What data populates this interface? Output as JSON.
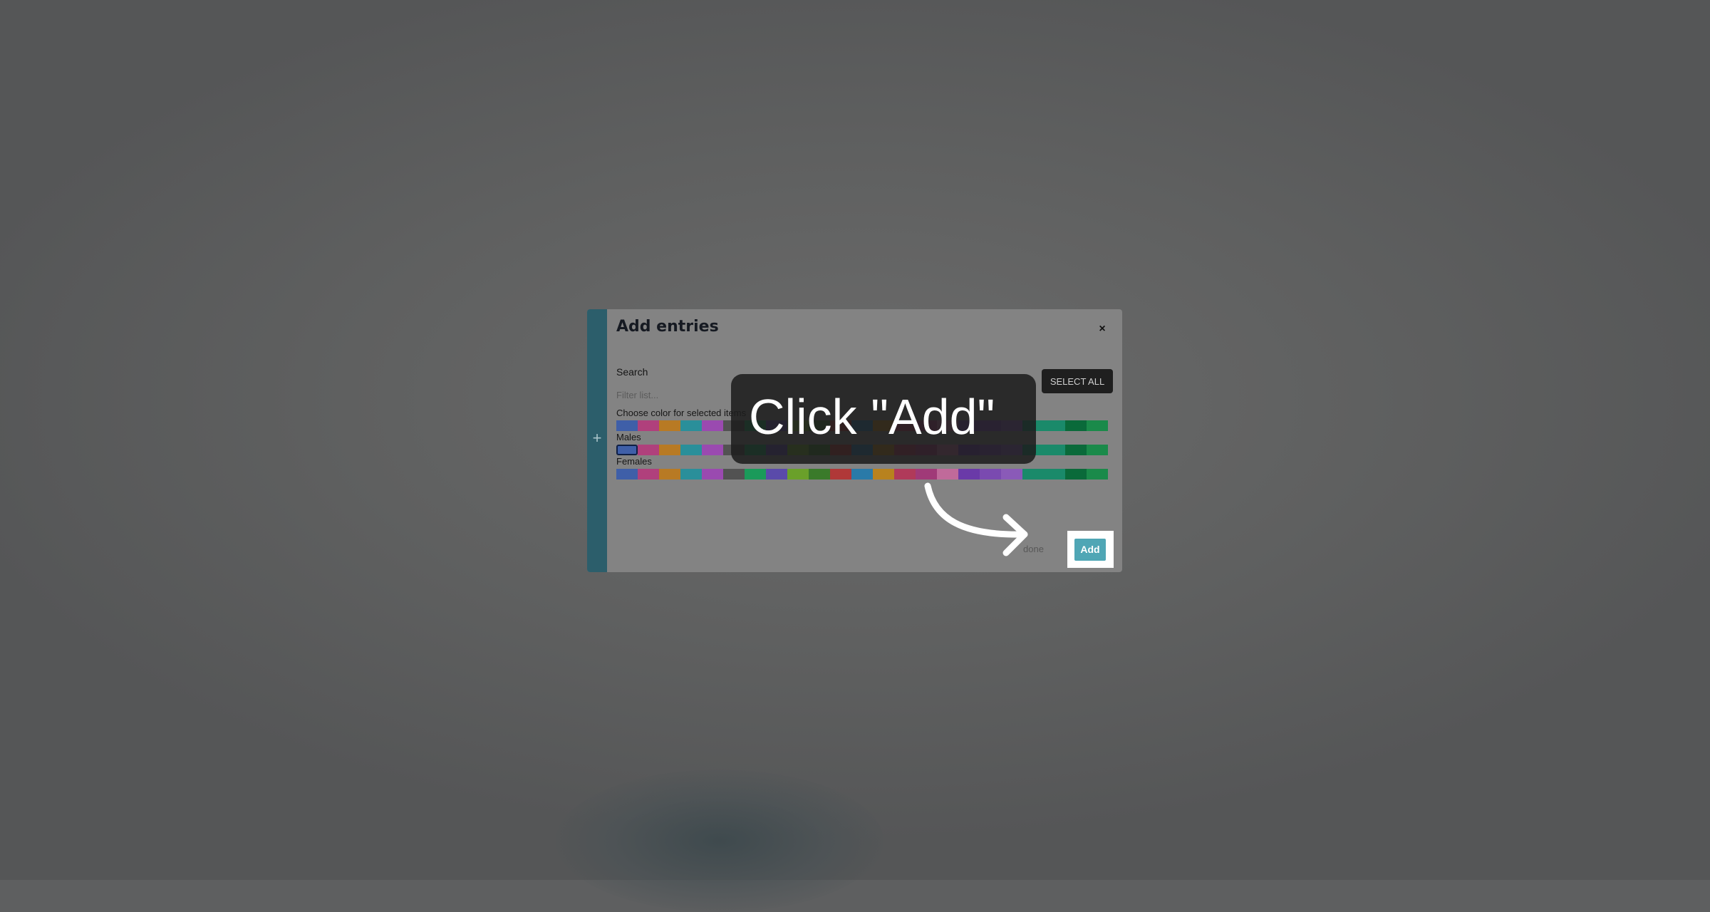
{
  "dialog": {
    "title": "Add entries",
    "close_label": "×",
    "side_plus": "+",
    "search_label": "Search",
    "filter_placeholder": "Filter list...",
    "select_all_label": "SELECT ALL",
    "done_label": "done",
    "add_label": "Add"
  },
  "rows": [
    {
      "label": "Choose color for selected items",
      "selected_index": -1
    },
    {
      "label": "Males",
      "selected_index": 0
    },
    {
      "label": "Females",
      "selected_index": -1
    }
  ],
  "palette": [
    "#3f5fa8",
    "#b0407c",
    "#b87a24",
    "#2a8f9a",
    "#9a4ab0",
    "#525252",
    "#1a9a5a",
    "#5a4aaa",
    "#6aa02a",
    "#3a7a2a",
    "#b03838",
    "#2a7aa8",
    "#b8821e",
    "#b03a5a",
    "#a03a78",
    "#c06a9a",
    "#6a3aa8",
    "#7a4ab0",
    "#8a5ab8",
    "#1a8a6a",
    "#1a8a6a",
    "#0a6a3a",
    "#1a8a4a"
  ],
  "tooltip": {
    "text": "Click \"Add\""
  },
  "colors": {
    "backdrop": "#5e5f60",
    "dialog_bg": "#838383",
    "side_strip": "#2c5e6b",
    "select_all_bg": "#1f1f1f",
    "add_button_bg": "#4fa6b5",
    "tooltip_bg": "#1c1c1c"
  }
}
